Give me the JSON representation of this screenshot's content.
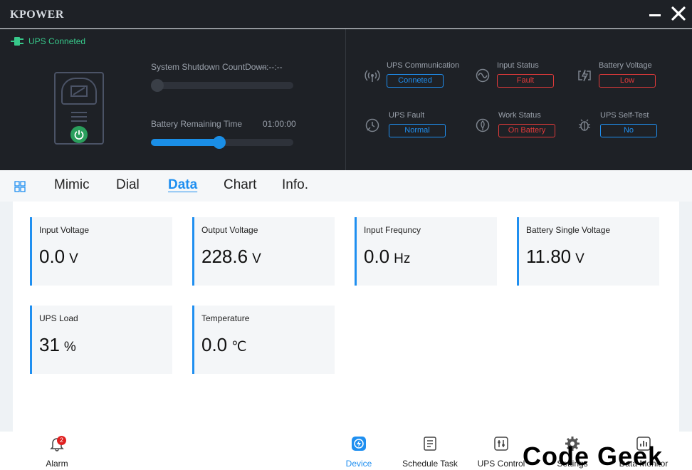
{
  "app": {
    "brand": "KPOWER"
  },
  "connection": {
    "text": "UPS Conneted",
    "color": "#37c88a"
  },
  "shutdown": {
    "label": "System Shutdown CountDown",
    "value": "--:--:--",
    "progress": 0
  },
  "battery_time": {
    "label": "Battery Remaining Time",
    "value": "01:00:00",
    "progress": 0.5
  },
  "status_items": [
    {
      "title": "UPS Communication",
      "value": "Conneted",
      "level": "ok",
      "icon": "signal-icon"
    },
    {
      "title": "Input Status",
      "value": "Fault",
      "level": "fault",
      "icon": "sine-wave-icon"
    },
    {
      "title": "Battery Voltage",
      "value": "Low",
      "level": "fault",
      "icon": "battery-charge-icon"
    },
    {
      "title": "UPS Fault",
      "value": "Normal",
      "level": "ok",
      "icon": "clock-fault-icon"
    },
    {
      "title": "Work Status",
      "value": "On Battery",
      "level": "fault",
      "icon": "leaf-icon"
    },
    {
      "title": "UPS Self-Test",
      "value": "No",
      "level": "ok",
      "icon": "bug-icon"
    }
  ],
  "tabs": [
    "Mimic",
    "Dial",
    "Data",
    "Chart",
    "Info."
  ],
  "active_tab": "Data",
  "cards": [
    {
      "title": "Input Voltage",
      "value": "0.0",
      "unit": "V"
    },
    {
      "title": "Output Voltage",
      "value": "228.6",
      "unit": "V"
    },
    {
      "title": "Input Frequncy",
      "value": "0.0",
      "unit": "Hz"
    },
    {
      "title": "Battery Single Voltage",
      "value": "11.80",
      "unit": "V"
    },
    {
      "title": "UPS Load",
      "value": "31",
      "unit": "%"
    },
    {
      "title": "Temperature",
      "value": "0.0",
      "unit": "℃"
    }
  ],
  "bottom_nav": [
    {
      "label": "Alarm",
      "icon": "bell-icon",
      "badge": "2"
    },
    {
      "label": "Device",
      "icon": "device-icon",
      "active": true
    },
    {
      "label": "Schedule Task",
      "icon": "schedule-icon"
    },
    {
      "label": "UPS Control",
      "icon": "control-icon"
    },
    {
      "label": "Settings",
      "icon": "gear-icon"
    },
    {
      "label": "Data Monitor",
      "icon": "chart-icon"
    }
  ],
  "watermark": "Code Geek",
  "colors": {
    "accent": "#1f8ff0",
    "fault": "#e23a3a",
    "ok_text": "#37c88a",
    "dark_bg": "#1e2126"
  }
}
